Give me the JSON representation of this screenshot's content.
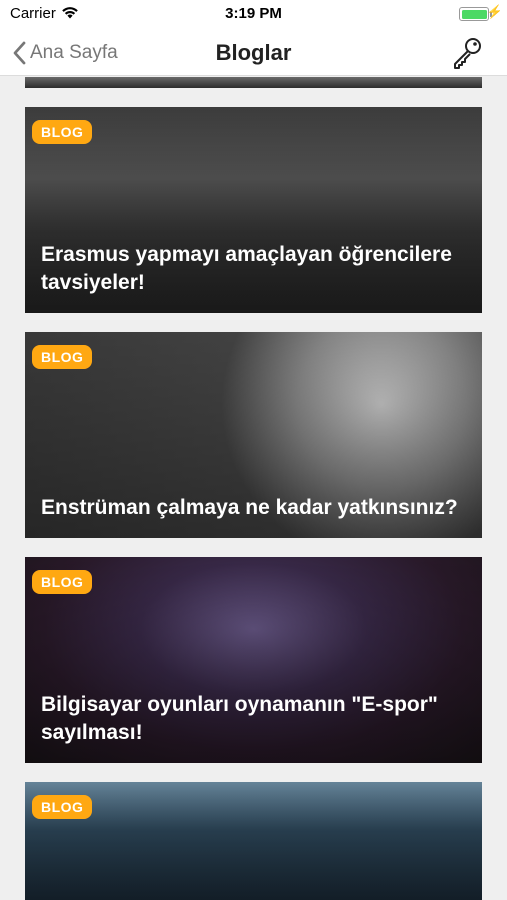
{
  "status": {
    "carrier": "Carrier",
    "time": "3:19 PM"
  },
  "nav": {
    "back_label": "Ana Sayfa",
    "title": "Bloglar",
    "action_icon": "key-icon"
  },
  "cards": [
    {
      "badge": "BLOG",
      "title": "Erasmus yapmayı amaçlayan öğrencilere tavsiyeler!"
    },
    {
      "badge": "BLOG",
      "title": "Enstrüman çalmaya ne kadar yatkınsınız?"
    },
    {
      "badge": "BLOG",
      "title": "Bilgisayar oyunları oynamanın \"E-spor\" sayılması!"
    },
    {
      "badge": "BLOG",
      "title": ""
    }
  ]
}
